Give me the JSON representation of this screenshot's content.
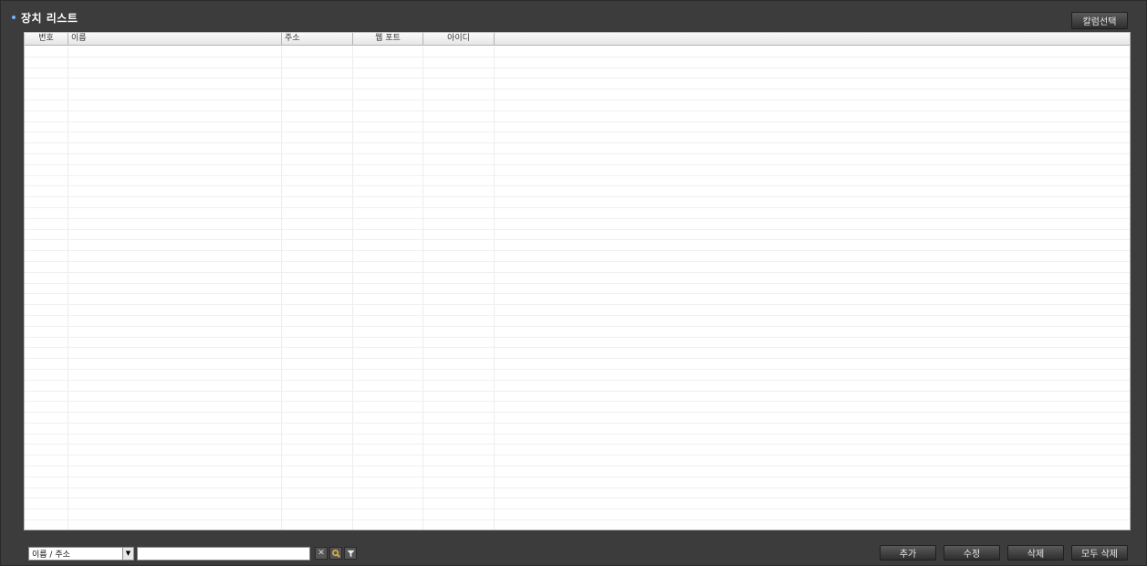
{
  "window": {
    "title": "장치 리스트",
    "column_select_label": "칼럼선택"
  },
  "table": {
    "columns": [
      {
        "label": "번호",
        "align": "center"
      },
      {
        "label": "이름",
        "align": "left"
      },
      {
        "label": "주소",
        "align": "left"
      },
      {
        "label": "웹 포트",
        "align": "center"
      },
      {
        "label": "아이디",
        "align": "center"
      },
      {
        "label": "",
        "align": "left"
      }
    ],
    "rows": []
  },
  "search": {
    "field_selected": "이름 / 주소",
    "query_value": "",
    "icons": {
      "clear": "close-icon",
      "search": "search-icon",
      "filter": "filter-icon"
    }
  },
  "actions": {
    "add": "추가",
    "edit": "수정",
    "delete": "삭제",
    "delete_all": "모두 삭제"
  },
  "colors": {
    "window_bg": "#3c3c3c",
    "accent_dot": "#6fb3ff",
    "search_icon": "#f5b93a"
  }
}
